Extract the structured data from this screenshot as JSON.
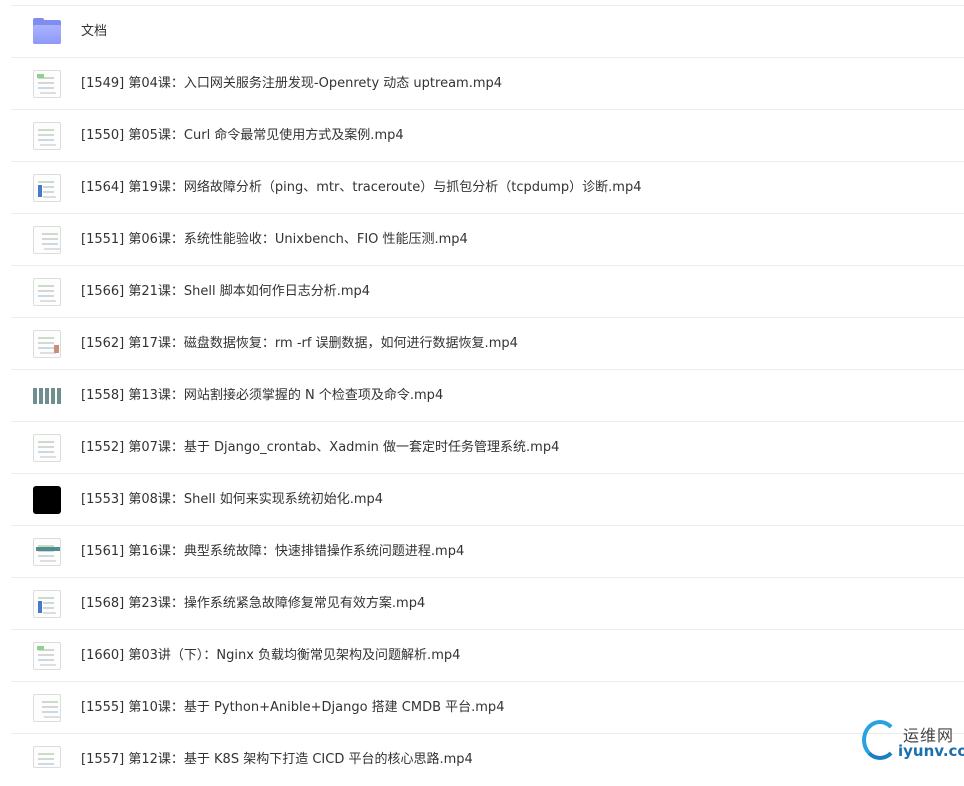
{
  "files": [
    {
      "name": "文档",
      "icon": "folder-icon"
    },
    {
      "name": "[1549] 第04课：入口网关服务注册发现-Openrety 动态 uptream.mp4",
      "icon": "video-thumbnail-icon"
    },
    {
      "name": "[1550] 第05课：Curl 命令最常见使用方式及案例.mp4",
      "icon": "video-thumbnail-icon"
    },
    {
      "name": "[1564] 第19课：网络故障分析（ping、mtr、traceroute）与抓包分析（tcpdump）诊断.mp4",
      "icon": "video-thumbnail-icon"
    },
    {
      "name": "[1551] 第06课：系统性能验收：Unixbench、FIO 性能压测.mp4",
      "icon": "video-thumbnail-icon"
    },
    {
      "name": "[1566] 第21课：Shell 脚本如何作日志分析.mp4",
      "icon": "video-thumbnail-icon"
    },
    {
      "name": "[1562] 第17课：磁盘数据恢复：rm -rf 误删数据，如何进行数据恢复.mp4",
      "icon": "video-thumbnail-icon"
    },
    {
      "name": "[1558] 第13课：网站割接必须掌握的 N 个检查项及命令.mp4",
      "icon": "video-thumbnail-icon"
    },
    {
      "name": "[1552] 第07课：基于 Django_crontab、Xadmin 做一套定时任务管理系统.mp4",
      "icon": "video-thumbnail-icon"
    },
    {
      "name": "[1553] 第08课：Shell 如何来实现系统初始化.mp4",
      "icon": "video-thumbnail-icon"
    },
    {
      "name": "[1561] 第16课：典型系统故障：快速排错操作系统问题进程.mp4",
      "icon": "video-thumbnail-icon"
    },
    {
      "name": "[1568] 第23课：操作系统紧急故障修复常见有效方案.mp4",
      "icon": "video-thumbnail-icon"
    },
    {
      "name": "[1660] 第03讲（下）：Nginx 负载均衡常见架构及问题解析.mp4",
      "icon": "video-thumbnail-icon"
    },
    {
      "name": "[1555] 第10课：基于 Python+Anible+Django 搭建 CMDB 平台.mp4",
      "icon": "video-thumbnail-icon"
    },
    {
      "name": "[1557] 第12课：基于 K8S 架构下打造 CICD 平台的核心思路.mp4",
      "icon": "video-thumbnail-icon"
    }
  ],
  "watermark": {
    "cn": "运维网",
    "en": "iyunv.com"
  }
}
